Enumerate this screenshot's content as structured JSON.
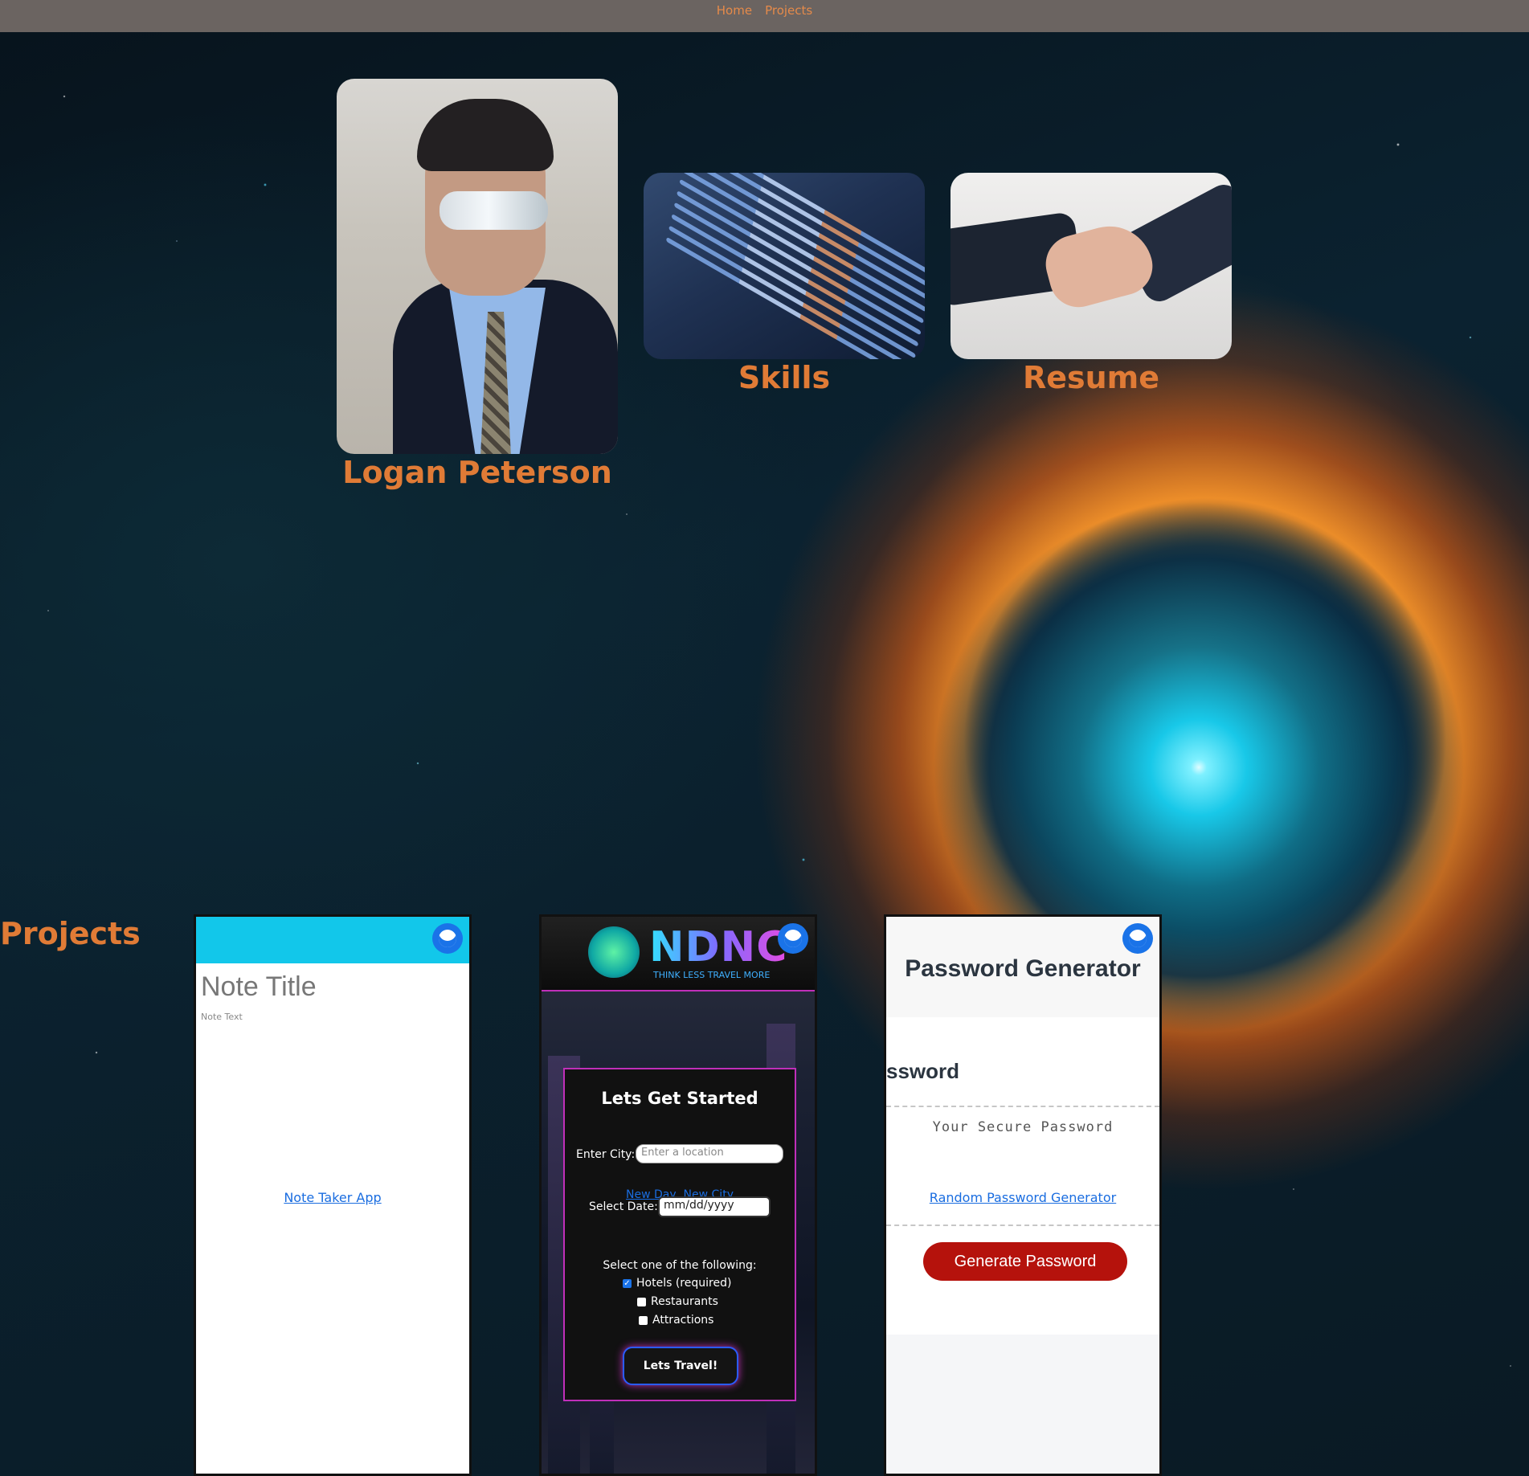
{
  "nav": {
    "home": "Home",
    "projects": "Projects"
  },
  "profile": {
    "name": "Logan Peterson"
  },
  "tiles": {
    "skills": "Skills",
    "resume": "Resume"
  },
  "projects": {
    "heading": "Projects",
    "cards": [
      {
        "title": "Note Title",
        "text": "Note Text",
        "link": "Note Taker App"
      },
      {
        "logo": "NDNC",
        "tagline": "THINK LESS TRAVEL MORE",
        "panel_title": "Lets Get Started",
        "city_label": "Enter City:",
        "city_placeholder": "Enter a location",
        "link": "New Day, New City",
        "date_label": "Select Date:",
        "date_value": "mm/dd/yyyy",
        "select_label": "Select one of the following:",
        "options": [
          {
            "label": "Hotels (required)",
            "checked": true
          },
          {
            "label": "Restaurants",
            "checked": false
          },
          {
            "label": "Attractions",
            "checked": false
          }
        ],
        "button": "Lets Travel!"
      },
      {
        "title": "Password Generator",
        "partial_heading": "ssword",
        "placeholder": "Your Secure Password",
        "link": "Random Password Generator",
        "button": "Generate Password"
      }
    ]
  },
  "colors": {
    "accent": "#e07b36",
    "nav_bg": "#6b6461",
    "link": "#1a6de0",
    "generate_btn": "#b5120c",
    "note_bar": "#12c7ea"
  },
  "icons": {
    "github": "github-icon"
  }
}
